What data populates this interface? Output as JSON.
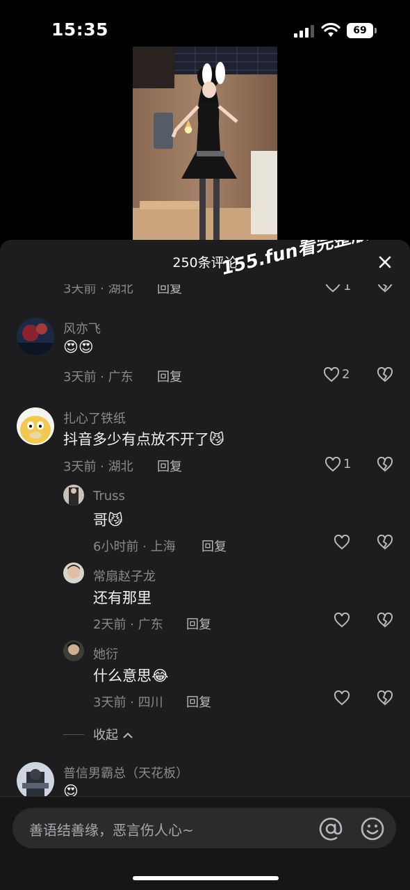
{
  "status": {
    "time": "15:35",
    "battery": "69"
  },
  "header": {
    "title": "250条评论",
    "watermark": "155.fun看完整版"
  },
  "partial_comment": {
    "meta": "3天前 · 湖北",
    "reply": "回复",
    "likes": "1"
  },
  "comments": [
    {
      "username": "风亦飞",
      "text": "😍😍",
      "meta": "3天前 · 广东",
      "reply": "回复",
      "likes": "2"
    },
    {
      "username": "扎心了铁纸",
      "text": "抖音多少有点放不开了😼",
      "meta": "3天前 · 湖北",
      "reply": "回复",
      "likes": "1",
      "replies": [
        {
          "username": "Truss",
          "text": "哥😼",
          "meta": "6小时前 · 上海",
          "reply": "回复"
        },
        {
          "username": "常扇赵子龙",
          "text": "还有那里",
          "meta": "2天前 · 广东",
          "reply": "回复"
        },
        {
          "username": "她衍",
          "text": "什么意思😂",
          "meta": "3天前 · 四川",
          "reply": "回复"
        }
      ],
      "collapse_label": "收起"
    },
    {
      "username": "普信男霸总（天花板）",
      "text": "😍"
    }
  ],
  "input": {
    "placeholder": "善语结善缘，恶言伤人心~"
  },
  "icons": [
    "signal-icon",
    "wifi-icon",
    "battery-icon",
    "close-icon",
    "heart-icon",
    "broken-heart-icon",
    "at-icon",
    "emoji-icon",
    "chevron-up-icon"
  ]
}
